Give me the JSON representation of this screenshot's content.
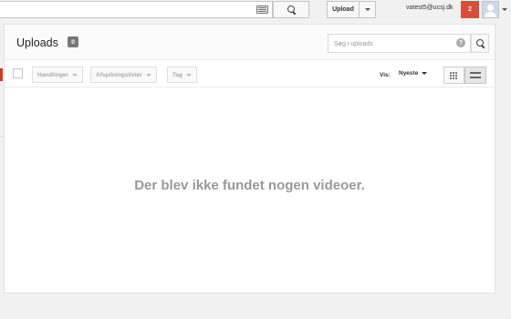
{
  "topbar": {
    "search_placeholder": "",
    "upload_label": "Upload",
    "user_email": "vatest5@ucsj.dk",
    "notification_count": "2"
  },
  "header": {
    "title": "Uploads",
    "count": "0",
    "search_placeholder": "Søg i uploads",
    "help": "?"
  },
  "toolbar": {
    "actions_label": "Handlinger",
    "playlists_label": "Afspilningslister",
    "tag_label": "Tag",
    "sort_label": "Vis:",
    "sort_value": "Nyeste"
  },
  "main": {
    "empty_message": "Der blev ikke fundet nogen videoer."
  },
  "colors": {
    "notification": "#dd4b39",
    "side_marker": "#cc3b29"
  }
}
